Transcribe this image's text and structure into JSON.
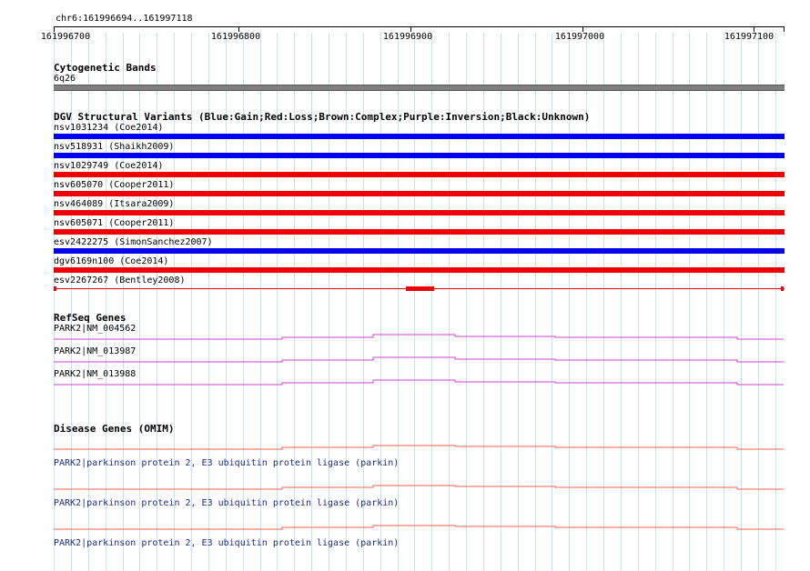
{
  "ruler": {
    "region": "chr6:161996694..161997118",
    "ticks": [
      "161996700",
      "161996800",
      "161996900",
      "161997000",
      "161997100"
    ]
  },
  "cytoband": {
    "title": "Cytogenetic Bands",
    "band": "6q26",
    "color": "#7f7f7f"
  },
  "dgv": {
    "title": "DGV Structural Variants (Blue:Gain;Red:Loss;Brown:Complex;Purple:Inversion;Black:Unknown)",
    "gain_color": "#0000ee",
    "loss_color": "#ee0000",
    "variants": [
      {
        "label": "nsv1031234 (Coe2014)",
        "type": "gain"
      },
      {
        "label": "nsv518931 (Shaikh2009)",
        "type": "gain"
      },
      {
        "label": "nsv1029749 (Coe2014)",
        "type": "loss"
      },
      {
        "label": "nsv605070 (Cooper2011)",
        "type": "loss"
      },
      {
        "label": "nsv464089 (Itsara2009)",
        "type": "loss"
      },
      {
        "label": "nsv605071 (Cooper2011)",
        "type": "loss"
      },
      {
        "label": "esv2422275 (SimonSanchez2007)",
        "type": "gain"
      },
      {
        "label": "dgv6169n100 (Coe2014)",
        "type": "loss"
      },
      {
        "label": "esv2267267 (Bentley2008)",
        "type": "loss-thin"
      }
    ]
  },
  "refseq": {
    "title": "RefSeq Genes",
    "color": "#cc44cc",
    "genes": [
      {
        "label": "PARK2|NM_004562"
      },
      {
        "label": "PARK2|NM_013987"
      },
      {
        "label": "PARK2|NM_013988"
      }
    ]
  },
  "omim": {
    "title": "Disease Genes (OMIM)",
    "color": "#ee6655",
    "genes": [
      {
        "label": "PARK2|parkinson protein 2, E3 ubiquitin protein ligase (parkin)"
      },
      {
        "label": "PARK2|parkinson protein 2, E3 ubiquitin protein ligase (parkin)"
      },
      {
        "label": "PARK2|parkinson protein 2, E3 ubiquitin protein ligase (parkin)"
      }
    ]
  }
}
